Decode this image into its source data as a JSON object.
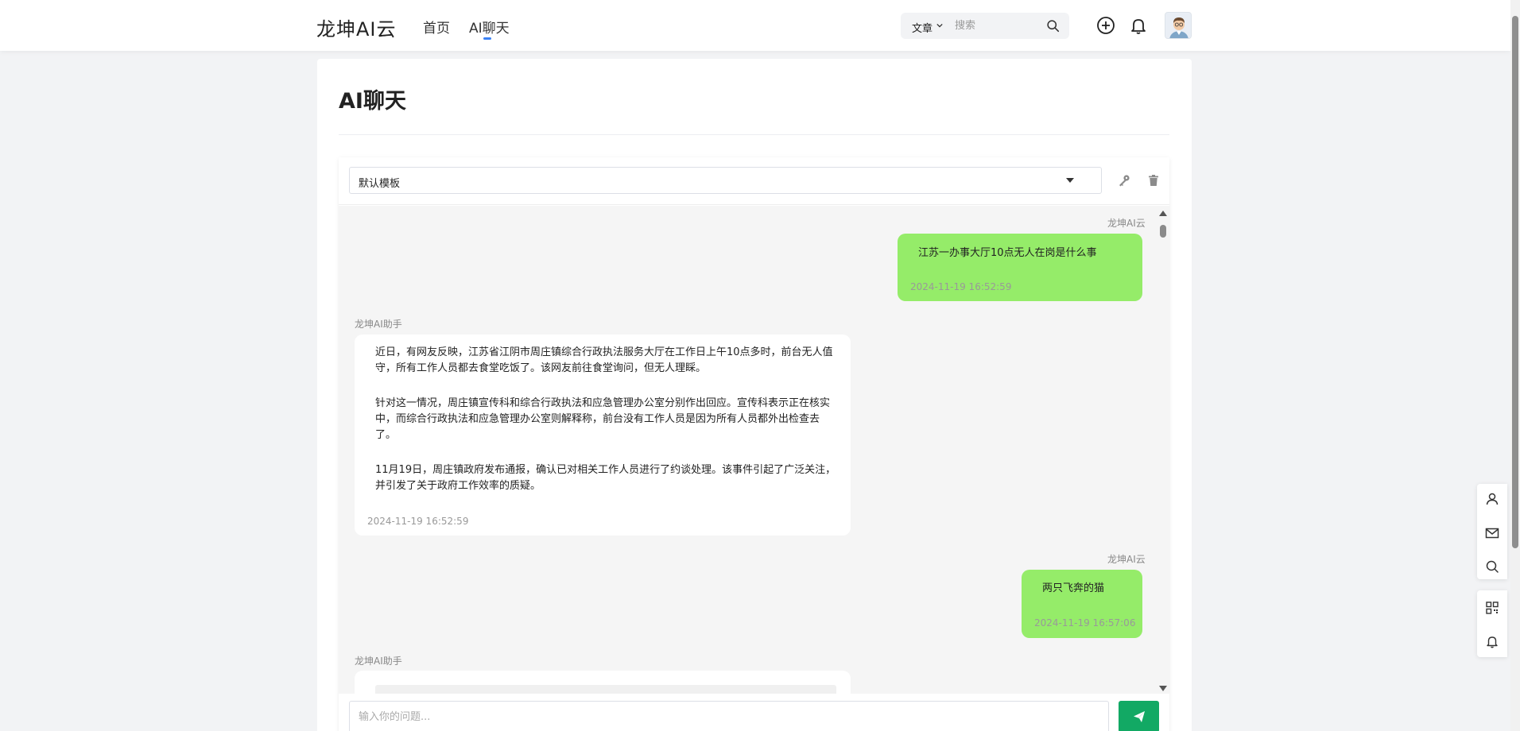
{
  "header": {
    "logo": "龙坤AI云",
    "nav": [
      {
        "label": "首页"
      },
      {
        "label": "AI聊天"
      }
    ],
    "search": {
      "category": "文章",
      "placeholder": "搜索"
    }
  },
  "page": {
    "title": "AI聊天"
  },
  "chat": {
    "template_value": "默认模板",
    "messages": [
      {
        "role": "user",
        "sender": "龙坤AI云",
        "text": "江苏一办事大厅10点无人在岗是什么事",
        "time": "2024-11-19 16:52:59"
      },
      {
        "role": "ai",
        "sender": "龙坤AI助手",
        "paragraphs": [
          "近日，有网友反映，江苏省江阴市周庄镇综合行政执法服务大厅在工作日上午10点多时，前台无人值守，所有工作人员都去食堂吃饭了。该网友前往食堂询问，但无人理睬。",
          "针对这一情况，周庄镇宣传科和综合行政执法和应急管理办公室分别作出回应。宣传科表示正在核实中，而综合行政执法和应急管理办公室则解释称，前台没有工作人员是因为所有人员都外出检查去了。",
          "11月19日，周庄镇政府发布通报，确认已对相关工作人员进行了约谈处理。该事件引起了广泛关注，并引发了关于政府工作效率的质疑。"
        ],
        "time": "2024-11-19 16:52:59"
      },
      {
        "role": "user",
        "sender": "龙坤AI云",
        "text": "两只飞奔的猫",
        "time": "2024-11-19 16:57:06"
      },
      {
        "role": "ai",
        "sender": "龙坤AI助手"
      }
    ],
    "input_placeholder": "输入你的问题..."
  },
  "colors": {
    "user_bubble": "#95ec69",
    "send_button": "#12a964",
    "nav_active_underline": "#3b82f6"
  },
  "icons": {
    "header": [
      "plus-circle-icon",
      "bell-icon",
      "avatar-icon"
    ],
    "toolbar": [
      "key-icon",
      "trash-icon"
    ],
    "side_panel": [
      "user-icon",
      "mail-icon",
      "search-icon",
      "qrcode-icon",
      "bell-icon"
    ]
  }
}
